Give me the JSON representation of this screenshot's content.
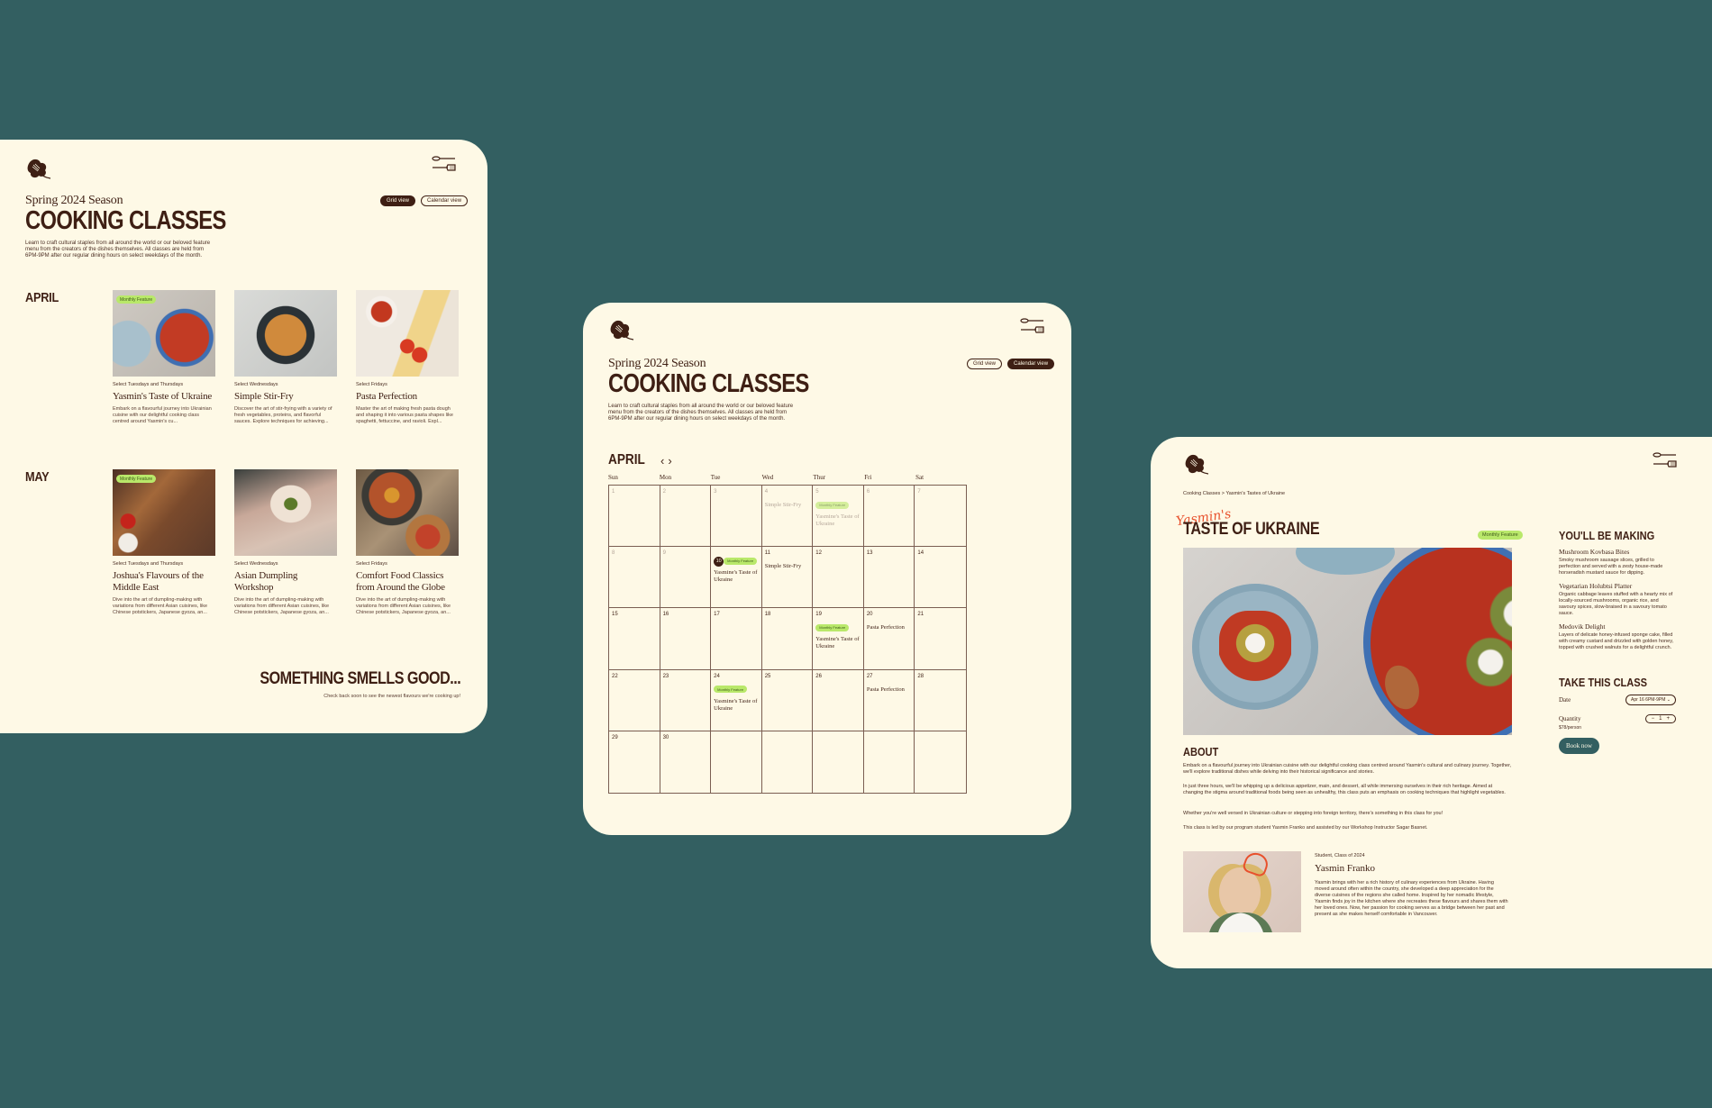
{
  "colors": {
    "background": "#335f61",
    "panel": "#fef9e6",
    "brown": "#3e1f14",
    "badge": "#b9e86a",
    "accent": "#e8502c",
    "button": "#335f61"
  },
  "icons": {
    "logo": "leaf-whisk-logo-icon",
    "menu": "spoon-fork-menu-icon",
    "prev": "chevron-left-icon",
    "next": "chevron-right-icon",
    "dropdown": "chevron-down-icon"
  },
  "header": {
    "season": "Spring 2024 Season",
    "title": "COOKING CLASSES",
    "intro": "Learn to craft cultural staples from all around the world or our beloved feature menu from the creators of the dishes themselves. All classes are held from 6PM-9PM after our regular dining hours on select weekdays of the month.",
    "grid_view": "Grid view",
    "calendar_view": "Calendar view"
  },
  "grid": {
    "months": [
      {
        "label": "APRIL",
        "cards": [
          {
            "badge": "Monthly Feature",
            "schedule": "Select Tuesdays and Thursdays",
            "title": "Yasmin's Taste of Ukraine",
            "desc": "Embark on a flavourful journey into Ukrainian cuisine with our delightful cooking class centred around Yasmin's cu..."
          },
          {
            "badge": "",
            "schedule": "Select Wednesdays",
            "title": "Simple Stir-Fry",
            "desc": "Discover the art of stir-frying with a variety of fresh vegetables, proteins, and flavorful sauces. Explore techniques for achieving..."
          },
          {
            "badge": "",
            "schedule": "Select Fridays",
            "title": "Pasta Perfection",
            "desc": "Master the art of making fresh pasta dough and shaping it into various pasta shapes like spaghetti, fettuccine, and ravioli. Expl..."
          }
        ]
      },
      {
        "label": "MAY",
        "cards": [
          {
            "badge": "Monthly Feature",
            "schedule": "Select Tuesdays and Thursdays",
            "title": "Joshua's Flavours of the Middle East",
            "desc": "Dive into the art of dumpling-making with variations from different Asian cuisines, like Chinese potstickers, Japanese gyoza, an..."
          },
          {
            "badge": "",
            "schedule": "Select Wednesdays",
            "title": "Asian Dumpling Workshop",
            "desc": "Dive into the art of dumpling-making with variations from different Asian cuisines, like Chinese potstickers, Japanese gyoza, an..."
          },
          {
            "badge": "",
            "schedule": "Select Fridays",
            "title": "Comfort Food Classics from Around the Globe",
            "desc": "Dive into the art of dumpling-making with variations from different Asian cuisines, like Chinese potstickers, Japanese gyoza, an..."
          }
        ]
      }
    ],
    "footer_title": "SOMETHING SMELLS GOOD...",
    "footer_sub": "Check back soon to see the newest flavours we're cooking up!"
  },
  "calendar": {
    "month": "APRIL",
    "weekdays": [
      "Sun",
      "Mon",
      "Tue",
      "Wed",
      "Thur",
      "Fri",
      "Sat"
    ],
    "today": 10,
    "cells": [
      {
        "day": "1",
        "past": true
      },
      {
        "day": "2",
        "past": true
      },
      {
        "day": "3",
        "past": true
      },
      {
        "day": "4",
        "past": true,
        "event": "Simple Stir-Fry"
      },
      {
        "day": "5",
        "past": true,
        "badge": "Monthly Feature",
        "event": "Yasmine's Taste of Ukraine"
      },
      {
        "day": "6",
        "past": true
      },
      {
        "day": "7",
        "past": true
      },
      {
        "day": "8",
        "past": true
      },
      {
        "day": "9",
        "past": true
      },
      {
        "day": "10",
        "badge": "Monthly Feature",
        "event": "Yasmine's Taste of Ukraine"
      },
      {
        "day": "11",
        "event": "Simple Stir-Fry"
      },
      {
        "day": "12"
      },
      {
        "day": "13"
      },
      {
        "day": "14"
      },
      {
        "day": "15"
      },
      {
        "day": "16"
      },
      {
        "day": "17"
      },
      {
        "day": "18"
      },
      {
        "day": "19",
        "badge": "Monthly Feature",
        "event": "Yasmine's Taste of Ukraine"
      },
      {
        "day": "20",
        "event": "Pasta Perfection"
      },
      {
        "day": "21"
      },
      {
        "day": "22"
      },
      {
        "day": "23"
      },
      {
        "day": "24",
        "badge": "Monthly Feature",
        "event": "Yasmine's Taste of Ukraine"
      },
      {
        "day": "25"
      },
      {
        "day": "26"
      },
      {
        "day": "27",
        "event": "Pasta Perfection"
      },
      {
        "day": "28"
      },
      {
        "day": "29"
      },
      {
        "day": "30"
      },
      {
        "day": ""
      },
      {
        "day": ""
      },
      {
        "day": ""
      },
      {
        "day": ""
      },
      {
        "day": ""
      }
    ]
  },
  "detail": {
    "breadcrumb": "Cooking Classes > Yasmin's Tastes of Ukraine",
    "script": "Yasmin's",
    "title": "TASTE OF UKRAINE",
    "badge": "Monthly Feature",
    "about_heading": "ABOUT",
    "about": [
      "Embark on a flavourful journey into Ukrainian cuisine with our delightful cooking class centred around Yasmin's cultural and culinary journey. Together, we'll explore traditional dishes while delving into their historical significance and stories.",
      "In just three hours, we'll be whipping up a delicious appetizer, main, and dessert, all while immersing ourselves in their rich heritage. Aimed at changing the stigma around traditional foods being seen as unhealthy, this class puts an emphasis on cooking techniques that highlight vegetables.",
      "Whether you're well versed in Ukrainian culture or stepping into foreign territory, there's something in this class for you!",
      "This class is led by our program student Yasmin Franko and assisted by our Workshop Instructor Sagar Basnet."
    ],
    "instructor": {
      "role": "Student, Class of 2024",
      "name": "Yasmin Franko",
      "bio": "Yasmin brings with her a rich history of culinary experiences from Ukraine. Having moved around often within the country, she developed a deep appreciation for the diverse cuisines of the regions she called home. Inspired by her nomadic lifestyle, Yasmin finds joy in the kitchen where she  recreates these flavours and shares them with her loved ones. Now, her passion for cooking serves as a bridge between her past and present as she makes herself comfortable in Vancouver."
    },
    "making_heading": "YOU'LL BE MAKING",
    "dishes": [
      {
        "name": "Mushroom Kovbasa Bites",
        "desc": "Smoky mushroom sausage slices, grilled to perfection and served with a zesty house-made horseradish mustard sauce for dipping."
      },
      {
        "name": "Vegetarian Holubtsi Platter",
        "desc": "Organic cabbage leaves stuffed with a hearty mix of locally-sourced mushrooms, organic rice, and savoury spices, slow-braised in a savoury tomato sauce."
      },
      {
        "name": "Medovik Delight",
        "desc": "Layers of delicate honey-infused sponge cake, filled with creamy custard and drizzled with golden honey, topped with crushed walnuts for a delightful crunch."
      }
    ],
    "take_heading": "TAKE THIS CLASS",
    "date_label": "Date",
    "date_value": "Apr 16 6PM-9PM",
    "quantity_label": "Quantity",
    "quantity_value": "1",
    "minus": "−",
    "plus": "+",
    "price": "$78/person",
    "book": "Book now"
  }
}
